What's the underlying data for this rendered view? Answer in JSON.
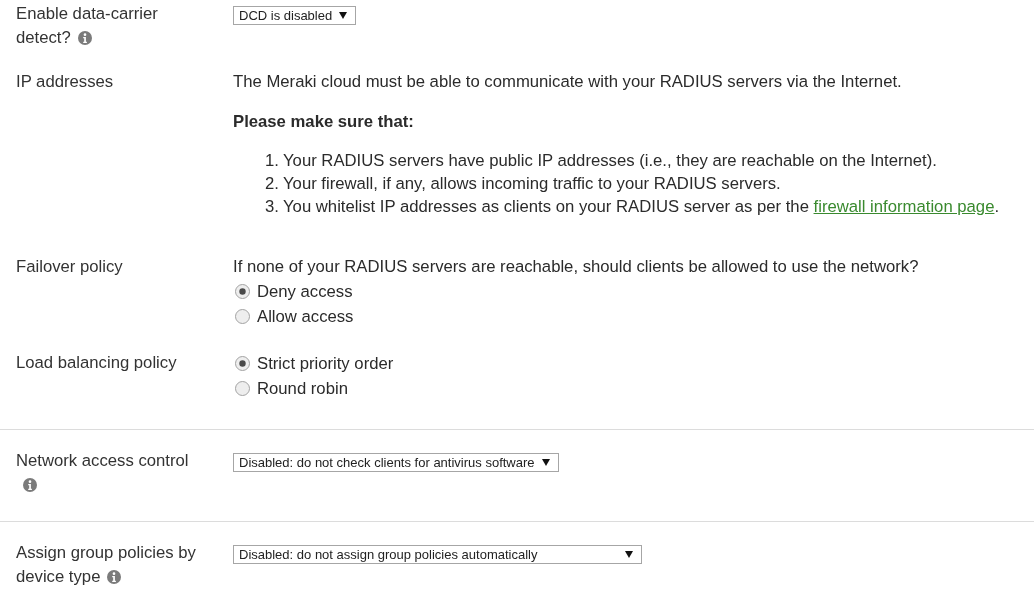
{
  "sections": [
    {
      "settings": [
        {
          "kind": "select",
          "label": "Enable data-carrier detect?",
          "info": true,
          "select": {
            "value": "DCD is disabled"
          }
        },
        {
          "kind": "notice",
          "label": "IP addresses",
          "info": false,
          "paragraph": "The Meraki cloud must be able to communicate with your RADIUS servers via the Internet.",
          "heading": "Please make sure that:",
          "steps": [
            {
              "number": "1.",
              "text": "Your RADIUS servers have public IP addresses (i.e., they are reachable on the Internet)."
            },
            {
              "number": "2.",
              "text": "Your firewall, if any, allows incoming traffic to your RADIUS servers."
            },
            {
              "number": "3.",
              "text": "You whitelist IP addresses as clients on your RADIUS server as per the ",
              "link": "firewall information page",
              "after": "."
            }
          ]
        },
        {
          "kind": "radios",
          "label": "Failover policy",
          "info": false,
          "question": "If none of your RADIUS servers are reachable, should clients be allowed to use the network?",
          "options": [
            {
              "label": "Deny access",
              "selected": true
            },
            {
              "label": "Allow access",
              "selected": false
            }
          ]
        },
        {
          "kind": "radios",
          "label": "Load balancing policy",
          "info": false,
          "options": [
            {
              "label": "Strict priority order",
              "selected": true
            },
            {
              "label": "Round robin",
              "selected": false
            }
          ]
        }
      ]
    },
    {
      "settings": [
        {
          "kind": "select",
          "label": "Network access control",
          "info": true,
          "select": {
            "value": "Disabled: do not check clients for antivirus software"
          }
        }
      ]
    },
    {
      "settings": [
        {
          "kind": "select",
          "label": "Assign group policies by device type",
          "info": true,
          "select": {
            "value": "Disabled: do not assign group policies automatically"
          }
        }
      ]
    }
  ]
}
